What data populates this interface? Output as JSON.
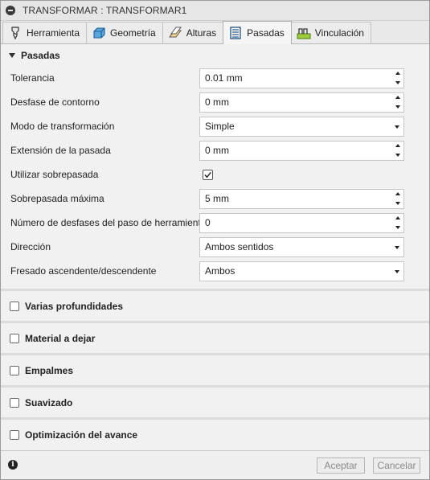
{
  "window": {
    "title": "TRANSFORMAR : TRANSFORMAR1"
  },
  "tabs": [
    {
      "label": "Herramienta",
      "icon": "tool-icon",
      "active": false
    },
    {
      "label": "Geometría",
      "icon": "geometry-icon",
      "active": false
    },
    {
      "label": "Alturas",
      "icon": "heights-icon",
      "active": false
    },
    {
      "label": "Pasadas",
      "icon": "passes-icon",
      "active": true
    },
    {
      "label": "Vinculación",
      "icon": "linking-icon",
      "active": false
    }
  ],
  "passes": {
    "header": "Pasadas",
    "rows": [
      {
        "label": "Tolerancia",
        "value": "0.01 mm",
        "type": "spinner"
      },
      {
        "label": "Desfase de contorno",
        "value": "0 mm",
        "type": "spinner"
      },
      {
        "label": "Modo de transformación",
        "value": "Simple",
        "type": "select"
      },
      {
        "label": "Extensión de la pasada",
        "value": "0 mm",
        "type": "spinner"
      },
      {
        "label": "Utilizar sobrepasada",
        "checked": true,
        "type": "checkbox"
      },
      {
        "label": "Sobrepasada máxima",
        "value": "5 mm",
        "type": "spinner"
      },
      {
        "label": "Número de desfases del paso de herramienta",
        "value": "0",
        "type": "spinner"
      },
      {
        "label": "Dirección",
        "value": "Ambos sentidos",
        "type": "select"
      },
      {
        "label": "Fresado ascendente/descendente",
        "value": "Ambos",
        "type": "select"
      }
    ]
  },
  "sections": [
    {
      "label": "Varias profundidades",
      "checked": false
    },
    {
      "label": "Material a dejar",
      "checked": false
    },
    {
      "label": "Empalmes",
      "checked": false
    },
    {
      "label": "Suavizado",
      "checked": false
    },
    {
      "label": "Optimización del avance",
      "checked": false
    }
  ],
  "footer": {
    "ok_label": "Aceptar",
    "cancel_label": "Cancelar"
  }
}
